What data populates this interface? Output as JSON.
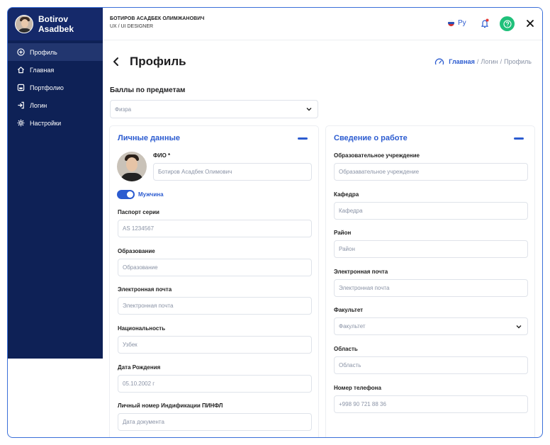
{
  "sidebar": {
    "user_name": "Botirov Asadbek",
    "items": [
      {
        "label": "Профиль",
        "icon": "plus-circle-icon",
        "active": true
      },
      {
        "label": "Главная",
        "icon": "home-icon",
        "active": false
      },
      {
        "label": "Портфолио",
        "icon": "portfolio-icon",
        "active": false
      },
      {
        "label": "Логин",
        "icon": "login-icon",
        "active": false
      },
      {
        "label": "Настройки",
        "icon": "gear-icon",
        "active": false
      }
    ]
  },
  "topbar": {
    "full_name": "БОТИРОВ АСАДБЕК ОЛИМЖАНОВИЧ",
    "role": "UX / UI DESIGNER",
    "language": "Ру"
  },
  "page": {
    "title": "Профиль",
    "breadcrumb": {
      "home": "Главная",
      "sep1": "/",
      "login": "Логин",
      "sep2": "/",
      "current": "Профиль"
    }
  },
  "scores": {
    "label": "Баллы по предметам",
    "selected": "Физра"
  },
  "personal": {
    "title": "Личные данные",
    "fio_label": "ФИО *",
    "fio_value": "Ботиров Асадбек Олимович",
    "gender_label": "Мужчина",
    "passport_label": "Паспорт серии",
    "passport_value": "AS 1234567",
    "education_label": "Образование",
    "education_placeholder": "Образование",
    "email_label": "Электронная почта",
    "email_placeholder": "Электронная почта",
    "nationality_label": "Национальность",
    "nationality_value": "Узбек",
    "birth_label": "Дата Рождения",
    "birth_value": "05.10.2002 г",
    "pinfl_label": "Личный номер Индификации ПИНФЛ",
    "pinfl_placeholder": "Дата документа"
  },
  "work": {
    "title": "Сведение о работе",
    "institution_label": "Образовательное учреждение",
    "institution_placeholder": "Образавательное учреждение",
    "department_label": "Кафедра",
    "department_placeholder": "Кафедра",
    "district_label": "Район",
    "district_placeholder": "Район",
    "email_label": "Электронная почта",
    "email_placeholder": "Электронная почта",
    "faculty_label": "Факультет",
    "faculty_placeholder": "Факультет",
    "region_label": "Область",
    "region_placeholder": "Область",
    "phone_label": "Номер телефона",
    "phone_placeholder": "+998 90 721 88 36"
  },
  "colors": {
    "sidebar": "#0e2156",
    "accent": "#2b5bd0",
    "help": "#1fc07a",
    "bell_dot": "#e53935"
  }
}
